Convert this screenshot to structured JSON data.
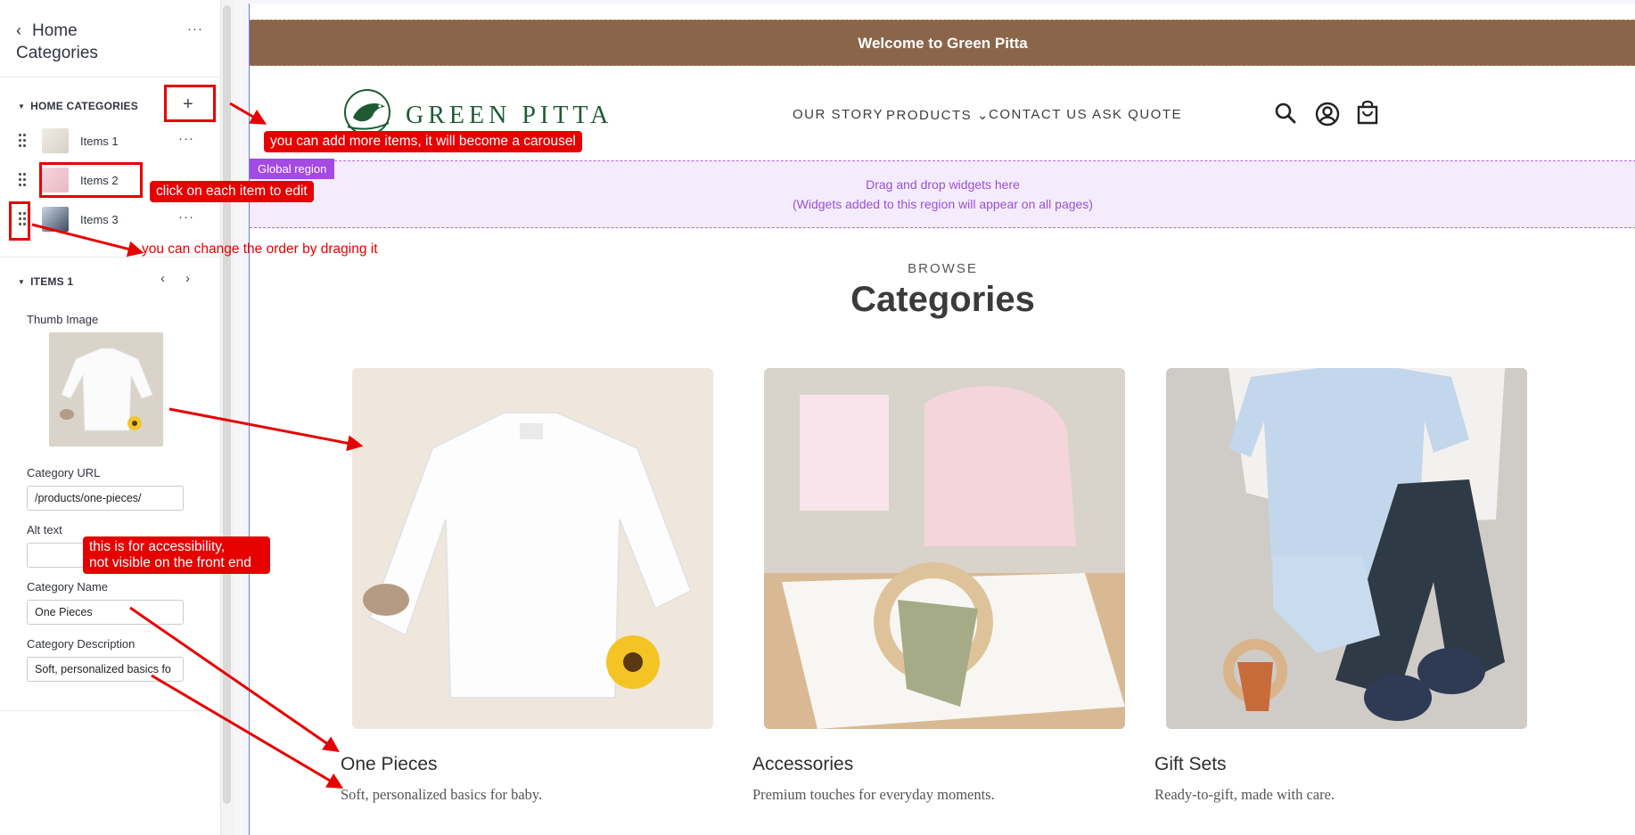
{
  "panel": {
    "back_label": "Home",
    "back_label_2": "Categories",
    "more": "···",
    "section_title": "HOME CATEGORIES",
    "add": "+",
    "items": [
      {
        "label": "Items 1"
      },
      {
        "label": "Items 2"
      },
      {
        "label": "Items 3"
      }
    ],
    "edit_section_title": "ITEMS 1",
    "prev": "‹",
    "next": "›",
    "fields": {
      "thumb_label": "Thumb Image",
      "url_label": "Category URL",
      "url_value": "/products/one-pieces/",
      "alt_label": "Alt text",
      "alt_value": "",
      "name_label": "Category Name",
      "name_value": "One Pieces",
      "desc_label": "Category Description",
      "desc_value": "Soft, personalized basics fo"
    }
  },
  "site": {
    "banner": "Welcome to Green Pitta",
    "logo_text": "GREEN PITTA",
    "nav": [
      "OUR STORY",
      "PRODUCTS",
      "CONTACT US",
      "ASK QUOTE"
    ],
    "nav_dropdown": "⌄",
    "icons": [
      "search-icon",
      "account-icon",
      "cart-icon"
    ],
    "global_tag": "Global region",
    "drop_line1": "Drag and drop widgets here",
    "drop_line2": "(Widgets added to this region will appear on all pages)",
    "browse": "BROWSE",
    "title": "Categories",
    "cards": [
      {
        "name": "One Pieces",
        "desc": "Soft, personalized basics for baby."
      },
      {
        "name": "Accessories",
        "desc": "Premium touches for everyday moments."
      },
      {
        "name": "Gift Sets",
        "desc": "Ready-to-gift, made with care."
      }
    ]
  },
  "annotations": {
    "add_more": "you can add more items, it will become a carousel",
    "click_edit": "click on each item to edit",
    "change_order": "you can change the order by draging it",
    "accessibility_1": "this is for accessibility,",
    "accessibility_2": "not visible on the front end"
  },
  "colors": {
    "banner": "#8b654a",
    "brand_green": "#1f5a35",
    "global_region": "#a449e3",
    "annotation_red": "#e60000"
  }
}
